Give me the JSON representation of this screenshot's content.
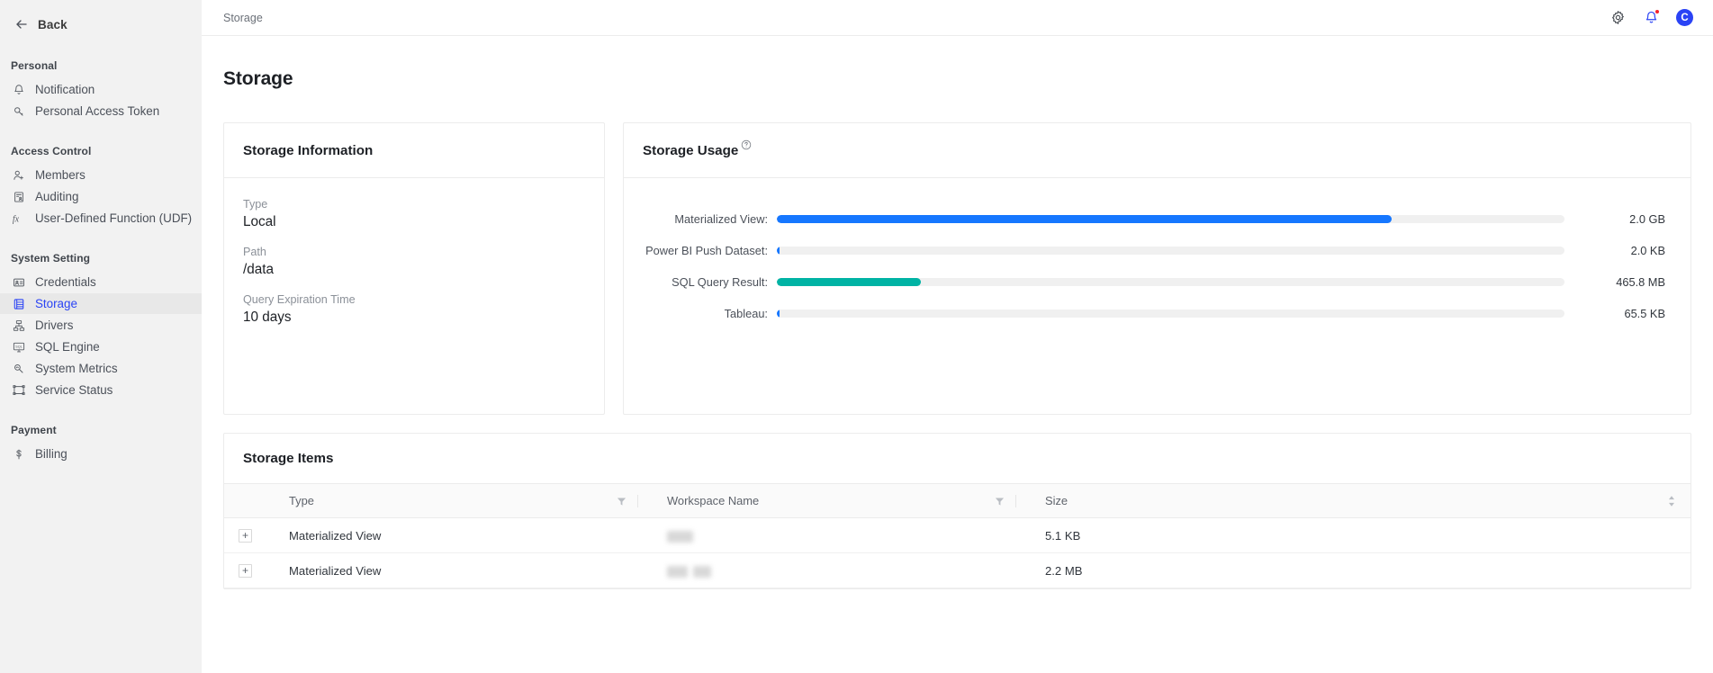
{
  "sidebar": {
    "back_label": "Back",
    "groups": [
      {
        "title": "Personal",
        "items": [
          {
            "label": "Notification",
            "icon": "bell-icon",
            "active": false
          },
          {
            "label": "Personal Access Token",
            "icon": "key-icon",
            "active": false
          }
        ]
      },
      {
        "title": "Access Control",
        "items": [
          {
            "label": "Members",
            "icon": "members-icon",
            "active": false
          },
          {
            "label": "Auditing",
            "icon": "auditing-icon",
            "active": false
          },
          {
            "label": "User-Defined Function (UDF)",
            "icon": "function-icon",
            "active": false
          }
        ]
      },
      {
        "title": "System Setting",
        "items": [
          {
            "label": "Credentials",
            "icon": "credentials-icon",
            "active": false
          },
          {
            "label": "Storage",
            "icon": "storage-icon",
            "active": true
          },
          {
            "label": "Drivers",
            "icon": "drivers-icon",
            "active": false
          },
          {
            "label": "SQL Engine",
            "icon": "sql-engine-icon",
            "active": false
          },
          {
            "label": "System Metrics",
            "icon": "metrics-icon",
            "active": false
          },
          {
            "label": "Service Status",
            "icon": "service-status-icon",
            "active": false
          }
        ]
      },
      {
        "title": "Payment",
        "items": [
          {
            "label": "Billing",
            "icon": "dollar-icon",
            "active": false
          }
        ]
      }
    ]
  },
  "topbar": {
    "breadcrumb": "Storage",
    "settings_icon": "gear-icon",
    "notification_icon": "bell-icon",
    "avatar_initial": "C",
    "has_notification_badge": true
  },
  "page": {
    "title": "Storage"
  },
  "storage_information": {
    "card_title": "Storage Information",
    "fields": [
      {
        "label": "Type",
        "value": "Local"
      },
      {
        "label": "Path",
        "value": "/data"
      },
      {
        "label": "Query Expiration Time",
        "value": "10 days"
      }
    ]
  },
  "storage_usage": {
    "card_title": "Storage Usage",
    "help_icon": "question-circle-icon"
  },
  "chart_data": {
    "type": "bar",
    "title": "Storage Usage",
    "orientation": "horizontal",
    "categories": [
      "Materialized View:",
      "Power BI Push Dataset:",
      "SQL Query Result:",
      "Tableau:"
    ],
    "value_labels": [
      "2.0 GB",
      "2.0 KB",
      "465.8 MB",
      "65.5 KB"
    ],
    "values_bytes": [
      2147483648,
      2048,
      488374272,
      67072
    ],
    "fill_percent": [
      78,
      0.3,
      18.3,
      0.3
    ],
    "colors": [
      "#1677ff",
      "#1677ff",
      "#00b3a4",
      "#1677ff"
    ],
    "track_color": "#f0f0f0",
    "xlabel": "",
    "ylabel": "",
    "grid": false,
    "legend": false
  },
  "storage_items": {
    "card_title": "Storage Items",
    "columns": [
      {
        "label": "Type",
        "filter_icon": "filter-icon",
        "sort_icon": null
      },
      {
        "label": "Workspace Name",
        "filter_icon": "filter-icon",
        "sort_icon": null
      },
      {
        "label": "Size",
        "filter_icon": null,
        "sort_icon": "sort-icon"
      }
    ],
    "expand_symbol": "+",
    "rows": [
      {
        "type": "Materialized View",
        "workspace_name": "",
        "workspace_redacted": 1,
        "size": "5.1 KB"
      },
      {
        "type": "Materialized View",
        "workspace_name": "",
        "workspace_redacted": 2,
        "size": "2.2 MB"
      }
    ]
  }
}
